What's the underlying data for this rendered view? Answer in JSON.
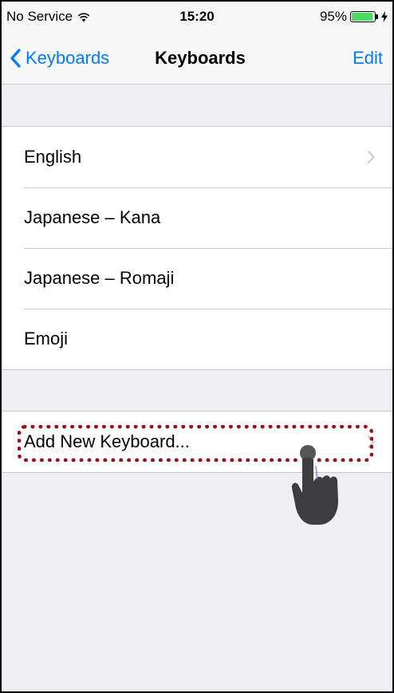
{
  "status": {
    "carrier": "No Service",
    "time": "15:20",
    "battery_percent": "95%",
    "battery_level": 0.95
  },
  "nav": {
    "back_label": "Keyboards",
    "title": "Keyboards",
    "edit_label": "Edit"
  },
  "keyboards": [
    "English",
    "Japanese – Kana",
    "Japanese – Romaji",
    "Emoji"
  ],
  "add_keyboard_label": "Add New Keyboard...",
  "colors": {
    "tint": "#007aff",
    "highlight": "#9a0e1d",
    "battery": "#4cd964"
  },
  "icons": [
    "wifi-icon",
    "battery-icon",
    "charging-bolt-icon",
    "back-chevron-icon",
    "disclosure-chevron-icon",
    "pointing-hand-icon"
  ]
}
